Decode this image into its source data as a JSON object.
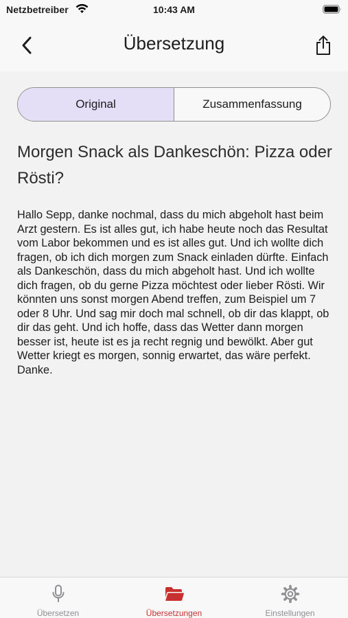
{
  "status_bar": {
    "carrier": "Netzbetreiber",
    "time": "10:43 AM"
  },
  "nav": {
    "title": "Übersetzung",
    "back_icon": "chevron-left-icon",
    "share_icon": "share-icon"
  },
  "segmented": {
    "options": [
      "Original",
      "Zusammenfassung"
    ],
    "selected": "Original",
    "selected_color": "#e5def7"
  },
  "content": {
    "title": "Morgen Snack als Dankeschön: Pizza oder Rösti?",
    "body": "Hallo Sepp, danke nochmal, dass du mich abgeholt hast beim Arzt gestern. Es ist alles gut, ich habe heute noch das Resultat vom Labor bekommen und es ist alles gut. Und ich wollte dich fragen, ob ich dich morgen zum Snack einladen dürfte. Einfach als Dankeschön, dass du mich abgeholt hast. Und ich wollte dich fragen, ob du gerne Pizza möchtest oder lieber Rösti. Wir könnten uns sonst morgen Abend treffen, zum Beispiel um 7 oder 8 Uhr. Und sag mir doch mal schnell, ob dir das klappt, ob dir das geht. Und ich hoffe, dass das Wetter dann morgen besser ist, heute ist es ja recht regnig und bewölkt. Aber gut Wetter kriegt es morgen, sonnig erwartet, das wäre perfekt. Danke."
  },
  "tabs": [
    {
      "label": "Übersetzen",
      "icon": "microphone-icon",
      "active": false
    },
    {
      "label": "Übersetzungen",
      "icon": "folder-icon",
      "active": true
    },
    {
      "label": "Einstellungen",
      "icon": "gear-icon",
      "active": false
    }
  ],
  "colors": {
    "accent": "#c8302f",
    "inactive": "#8e8e93",
    "background": "#f2f2f2"
  }
}
